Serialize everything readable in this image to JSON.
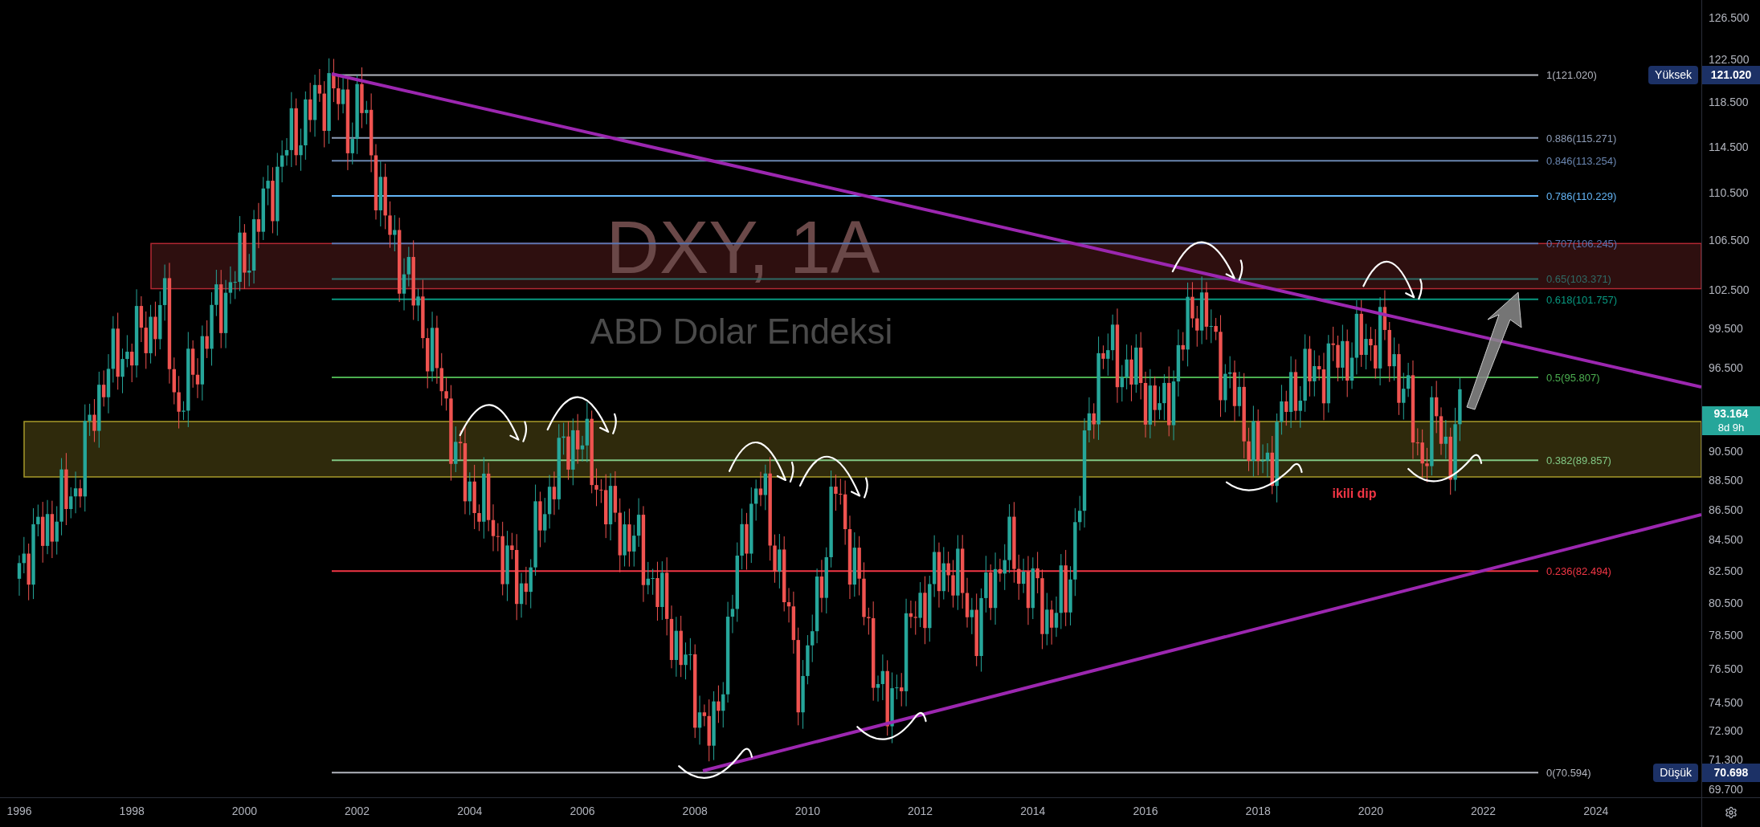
{
  "chart": {
    "watermark": {
      "symbol": "DXY, 1A",
      "name": "ABD Dolar Endeksi"
    },
    "fib_levels": [
      {
        "label": "1(121.020)",
        "color": "#b2b5be"
      },
      {
        "label": "0.886(115.271)",
        "color": "#8c9bb5"
      },
      {
        "label": "0.846(113.254)",
        "color": "#6a86b0"
      },
      {
        "label": "0.786(110.229)",
        "color": "#64b5f6"
      },
      {
        "label": "0.707(106.245)",
        "color": "#5a74b0"
      },
      {
        "label": "0.65(103.371)",
        "color": "#2f6b66"
      },
      {
        "label": "0.618(101.757)",
        "color": "#089981"
      },
      {
        "label": "0.5(95.807)",
        "color": "#4caf50"
      },
      {
        "label": "0.382(89.857)",
        "color": "#81c784"
      },
      {
        "label": "0.236(82.494)",
        "color": "#f23645"
      },
      {
        "label": "0(70.594)",
        "color": "#b2b5be"
      }
    ],
    "annotation": "ikili dip"
  },
  "price_axis": {
    "ticks": [
      "126.500",
      "122.500",
      "118.500",
      "114.500",
      "110.500",
      "106.500",
      "102.500",
      "99.500",
      "96.500",
      "90.500",
      "88.500",
      "86.500",
      "84.500",
      "82.500",
      "80.500",
      "78.500",
      "76.500",
      "74.500",
      "72.900",
      "71.300",
      "69.700"
    ],
    "high": {
      "label": "Yüksek",
      "value": "121.020"
    },
    "low": {
      "label": "Düşük",
      "value": "70.698"
    },
    "last": {
      "value": "93.164",
      "countdown": "8d 9h"
    }
  },
  "time_axis": {
    "ticks": [
      "1996",
      "1998",
      "2000",
      "2002",
      "2004",
      "2006",
      "2008",
      "2010",
      "2012",
      "2014",
      "2016",
      "2018",
      "2020",
      "2022",
      "2024"
    ]
  }
}
